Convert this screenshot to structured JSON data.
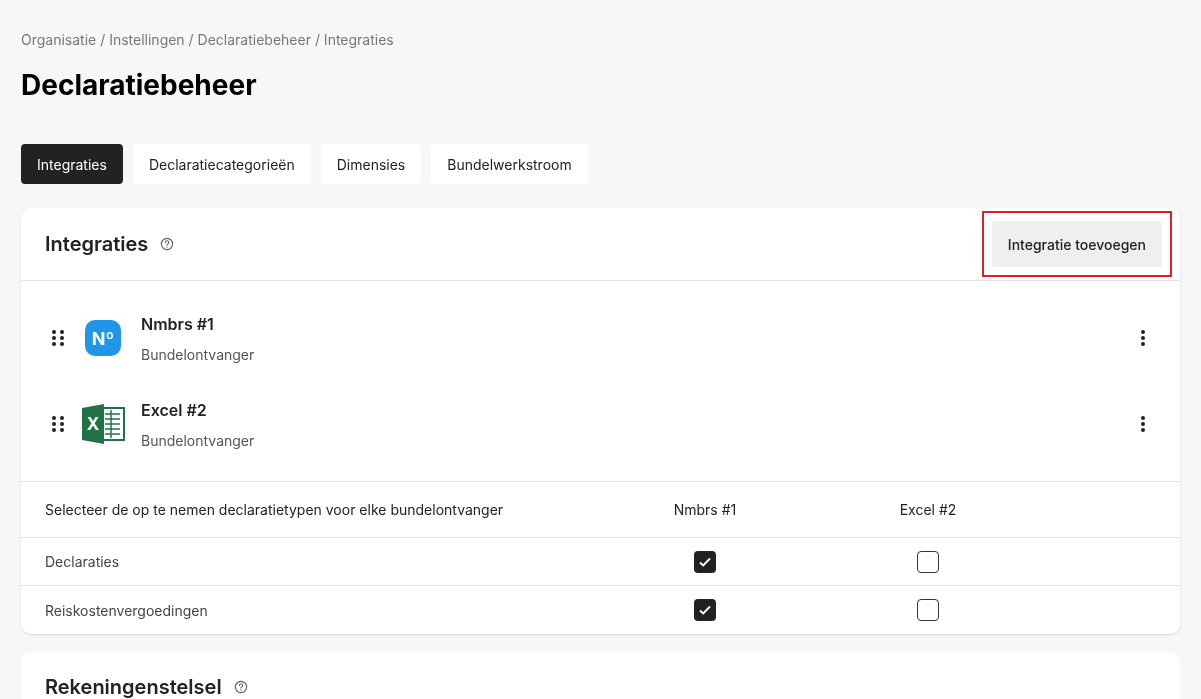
{
  "breadcrumb": "Organisatie / Instellingen / Declaratiebeheer / Integraties",
  "title": "Declaratiebeheer",
  "tabs": [
    {
      "label": "Integraties",
      "selected": true
    },
    {
      "label": "Declaratiecategorieën",
      "selected": false
    },
    {
      "label": "Dimensies",
      "selected": false
    },
    {
      "label": "Bundelwerkstroom",
      "selected": false
    }
  ],
  "integrations_card": {
    "title": "Integraties",
    "add_button": {
      "label": "Integratie toevoegen",
      "highlighted": true
    },
    "items": [
      {
        "name": "Nmbrs #1",
        "role": "Bundelontvanger",
        "kind": "nmbrs",
        "logo_text": "Nº"
      },
      {
        "name": "Excel #2",
        "role": "Bundelontvanger",
        "kind": "excel",
        "logo_text": "X"
      }
    ],
    "table": {
      "columns": [
        "Selecteer de op te nemen declaratietypen voor elke bundelontvanger",
        "Nmbrs #1",
        "Excel #2"
      ],
      "rows": [
        {
          "label": "Declaraties",
          "cells": [
            {
              "checked": true
            },
            {
              "checked": false
            }
          ]
        },
        {
          "label": "Reiskostenvergoedingen",
          "cells": [
            {
              "checked": true
            },
            {
              "checked": false
            }
          ]
        }
      ]
    }
  },
  "second_card": {
    "title": "Rekeningenstelsel"
  }
}
